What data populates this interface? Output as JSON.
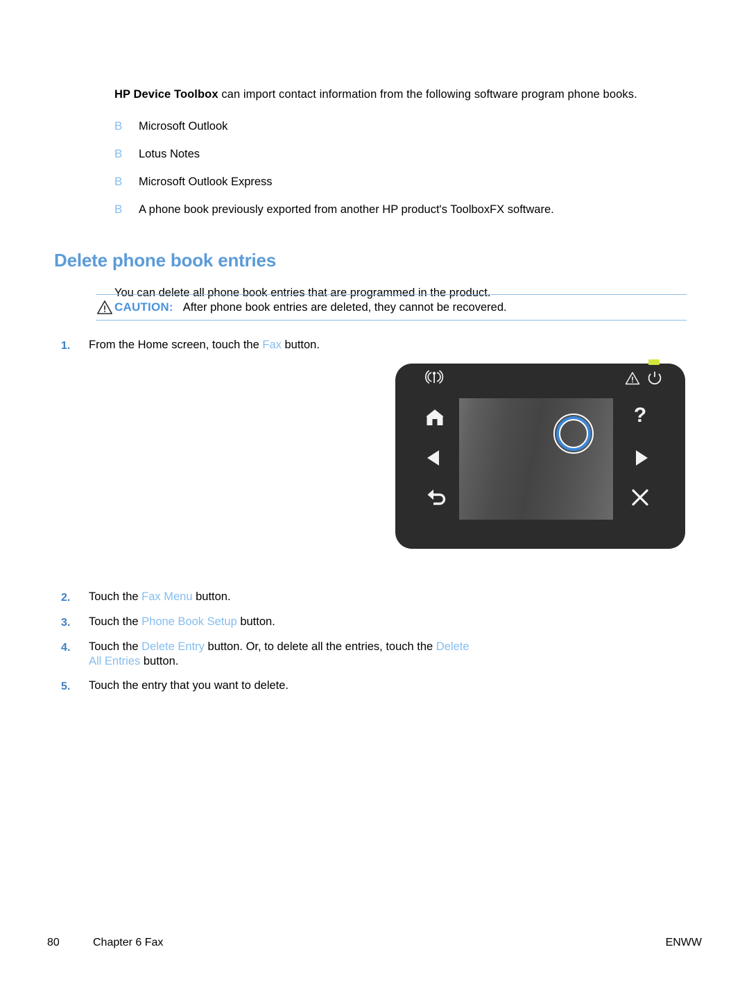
{
  "intro": {
    "bold_lead": "HP Device Toolbox",
    "rest": " can import contact information from the following software program phone books."
  },
  "bullet_marker": "B",
  "bullets": [
    {
      "text": "Microsoft Outlook"
    },
    {
      "text": "Lotus Notes"
    },
    {
      "text": "Microsoft Outlook Express"
    },
    {
      "text": "A phone book previously exported from another HP product's ToolboxFX software."
    }
  ],
  "heading": "Delete phone book entries",
  "lead_paragraph": "You can delete all phone book entries that are programmed in the product.",
  "caution": {
    "label": "CAUTION:",
    "text": "After phone book entries are deleted, they cannot be recovered.",
    "icon": "warning-triangle-icon"
  },
  "steps_top": [
    {
      "number": "1.",
      "parts": [
        {
          "text": "From the Home screen, touch the ",
          "ui": false
        },
        {
          "text": "Fax",
          "ui": true
        },
        {
          "text": " button.",
          "ui": false
        }
      ]
    }
  ],
  "steps_bottom": [
    {
      "number": "2.",
      "parts": [
        {
          "text": "Touch the ",
          "ui": false
        },
        {
          "text": "Fax Menu",
          "ui": true
        },
        {
          "text": " button.",
          "ui": false
        }
      ]
    },
    {
      "number": "3.",
      "parts": [
        {
          "text": "Touch the ",
          "ui": false
        },
        {
          "text": "Phone Book Setup",
          "ui": true
        },
        {
          "text": " button.",
          "ui": false
        }
      ]
    },
    {
      "number": "4.",
      "parts": [
        {
          "text": "Touch the ",
          "ui": false
        },
        {
          "text": "Delete Entry",
          "ui": true
        },
        {
          "text": " button. Or, to delete all the entries, touch the ",
          "ui": false
        },
        {
          "text": "Delete All Entries",
          "ui": true
        },
        {
          "text": " button.",
          "ui": false
        }
      ]
    },
    {
      "number": "5.",
      "parts": [
        {
          "text": "Touch the entry that you want to delete.",
          "ui": false
        }
      ]
    }
  ],
  "control_panel": {
    "caption": "",
    "led_color": "#d4e63a",
    "body_color": "#2c2c2c",
    "accent_ring_color": "#3b86d8",
    "icons": {
      "wireless": "wireless-icon",
      "attention": "attention-icon",
      "ready": "ready-icon",
      "home": "home-icon",
      "left_arrow": "left-arrow-icon",
      "back": "back-arrow-icon",
      "help": "help-icon",
      "right_arrow": "right-arrow-icon",
      "cancel": "cancel-icon"
    }
  },
  "footer": {
    "page_number": "80",
    "chapter": "Chapter 6   Fax",
    "locale": "ENWW"
  },
  "colors": {
    "heading_blue": "#5b9bd8",
    "caution_blue": "#4a93dd",
    "ui_term_blue": "#85bdf0",
    "step_number_blue": "#3f7fc4",
    "rule_blue": "#8fbde4"
  }
}
